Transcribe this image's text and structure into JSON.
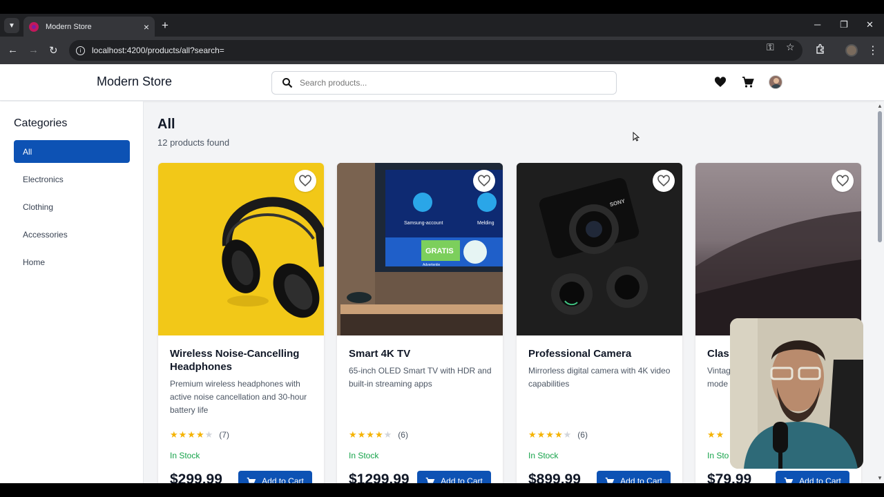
{
  "browser": {
    "tab_title": "Modern Store",
    "url": "localhost:4200/products/all?search="
  },
  "header": {
    "brand": "Modern Store",
    "search_placeholder": "Search products..."
  },
  "sidebar": {
    "title": "Categories",
    "items": [
      {
        "label": "All",
        "active": true
      },
      {
        "label": "Electronics",
        "active": false
      },
      {
        "label": "Clothing",
        "active": false
      },
      {
        "label": "Accessories",
        "active": false
      },
      {
        "label": "Home",
        "active": false
      }
    ]
  },
  "main": {
    "title": "All",
    "count_text": "12 products found",
    "products": [
      {
        "name": "Wireless Noise-Cancelling Headphones",
        "description": "Premium wireless headphones with active noise cancellation and 30-hour battery life",
        "rating": 4,
        "reviews": "(7)",
        "stock": "In Stock",
        "price": "$299.99",
        "button": "Add to Cart"
      },
      {
        "name": "Smart 4K TV",
        "description": "65-inch OLED Smart TV with HDR and built-in streaming apps",
        "rating": 4,
        "reviews": "(6)",
        "stock": "In Stock",
        "price": "$1299.99",
        "button": "Add to Cart"
      },
      {
        "name": "Professional Camera",
        "description": "Mirrorless digital camera with 4K video capabilities",
        "rating": 4,
        "reviews": "(6)",
        "stock": "In Stock",
        "price": "$899.99",
        "button": "Add to Cart"
      },
      {
        "name": "Clas",
        "description": "Vintag",
        "description2": "mode",
        "rating": 4,
        "reviews": "",
        "stock": "In Sto",
        "price": "$79.99",
        "button": "Add to Cart"
      }
    ],
    "tv_screen": {
      "label1": "Samsung-account",
      "label2": "Melding",
      "label3": "GRATIS",
      "label4": "Advertentie"
    },
    "camera_brand": "SONY"
  },
  "colors": {
    "accent": "#0d52b4",
    "stock": "#16a34a",
    "star": "#f5b301"
  }
}
